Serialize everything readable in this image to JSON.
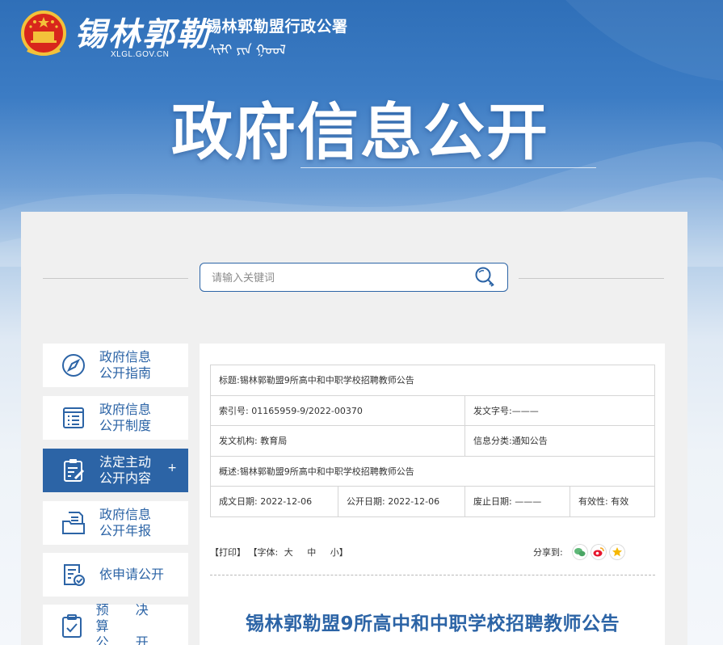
{
  "header": {
    "logo_script": "锡林郭勒",
    "domain": "XLGL.GOV.CN",
    "site_name": "锡林郭勒盟行政公署",
    "mongolian_text": "ᠰᠢᠯᠢ ᠶᠢᠨ ᠭᠣᠣᠯ"
  },
  "hero": {
    "title": "政府信息公开"
  },
  "search": {
    "placeholder": "请输入关键词",
    "icon": "search-key-icon"
  },
  "sidebar": {
    "items": [
      {
        "label1": "政府信息",
        "label2": "公开指南",
        "icon": "compass-icon",
        "active": false
      },
      {
        "label1": "政府信息",
        "label2": "公开制度",
        "icon": "document-list-icon",
        "active": false
      },
      {
        "label1": "法定主动",
        "label2": "公开内容",
        "icon": "clipboard-edit-icon",
        "active": true,
        "expand": "+"
      },
      {
        "label1": "政府信息",
        "label2": "公开年报",
        "icon": "folder-doc-icon",
        "active": false
      },
      {
        "label1": "依申请公开",
        "label2": "",
        "icon": "doc-check-icon",
        "active": false
      },
      {
        "label1": "预 决 算",
        "label2": "公  开",
        "icon": "clipboard-check-icon",
        "active": false
      }
    ]
  },
  "meta": {
    "title_label": "标题:",
    "title_value": "锡林郭勒盟9所高中和中职学校招聘教师公告",
    "index_label": "索引号:",
    "index_value": "01165959-9/2022-00370",
    "docno_label": "发文字号:",
    "docno_value": "———",
    "issuer_label": "发文机构:",
    "issuer_value": "教育局",
    "category_label": "信息分类:",
    "category_value": "通知公告",
    "summary_label": "概述:",
    "summary_value": "锡林郭勒盟9所高中和中职学校招聘教师公告",
    "created_label": "成文日期:",
    "created_value": "2022-12-06",
    "published_label": "公开日期:",
    "published_value": "2022-12-06",
    "abolished_label": "废止日期:",
    "abolished_value": "———",
    "validity_label": "有效性:",
    "validity_value": "有效"
  },
  "toolbar": {
    "print": "【打印】",
    "font_label": "【字体:",
    "font_large": "大",
    "font_medium": "中",
    "font_small": "小】",
    "share_label": "分享到:"
  },
  "share_icons": [
    "wechat-icon",
    "weibo-icon",
    "favorite-star-icon"
  ],
  "colors": {
    "brand_blue": "#2c64a6",
    "panel_bg": "#f0f0f0",
    "wechat": "#5fb878",
    "weibo": "#e6162d",
    "star": "#f5b700"
  },
  "document": {
    "title": "锡林郭勒盟9所高中和中职学校招聘教师公告"
  }
}
